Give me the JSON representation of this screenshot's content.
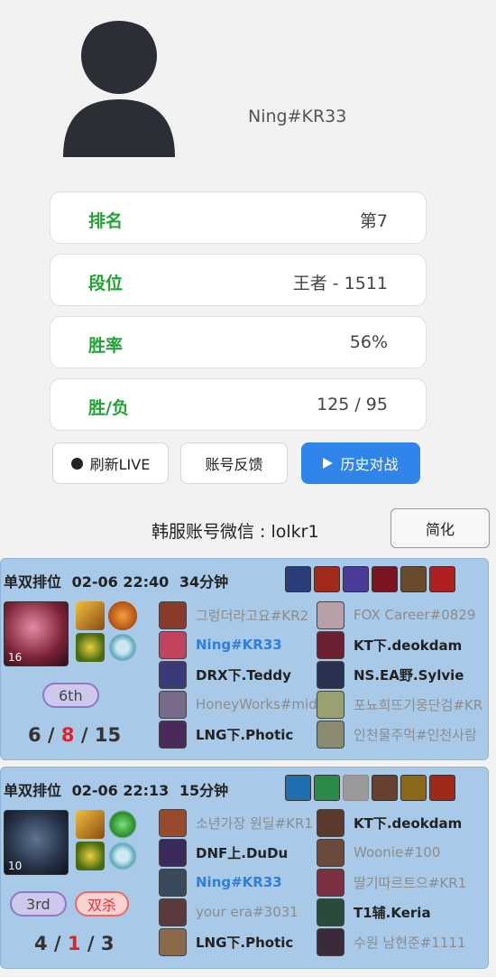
{
  "profile": {
    "name": "Ning#KR33"
  },
  "stats": [
    {
      "label": "排名",
      "value": "第7"
    },
    {
      "label": "段位",
      "value": "王者 - 1511"
    },
    {
      "label": "胜率",
      "value": "56%"
    },
    {
      "label": "胜/负",
      "value": "125 / 95"
    }
  ],
  "actions": {
    "refresh": "刷新LIVE",
    "feedback": "账号反馈",
    "history": "历史对战"
  },
  "wechat": "韩服账号微信 : lolkr1",
  "simplify": "简化",
  "matches": [
    {
      "mode": "单双排位",
      "time": "02-06 22:40",
      "duration": "34分钟",
      "level": "16",
      "rank": "6th",
      "multikill": "",
      "kda": {
        "k": "6",
        "d": "8",
        "a": "15"
      },
      "items": [
        "#2b3d7a",
        "#a22a1a",
        "#4a3a9a",
        "#7a1420",
        "#6a4a2a",
        "#b02020"
      ],
      "team_left": [
        {
          "name": "그렁더라고요#KR2",
          "style": "dim",
          "color": "#8a3a2a"
        },
        {
          "name": "Ning#KR33",
          "style": "me",
          "color": "#c0445e"
        },
        {
          "name": "DRX下.Teddy",
          "style": "bold",
          "color": "#3a3a7a"
        },
        {
          "name": "HoneyWorks#mid",
          "style": "dim",
          "color": "#7a6a8a"
        },
        {
          "name": "LNG下.Photic",
          "style": "bold",
          "color": "#4a2a5a"
        }
      ],
      "team_right": [
        {
          "name": "FOX Career#0829",
          "style": "dim",
          "color": "#b8a0a8"
        },
        {
          "name": "KT下.deokdam",
          "style": "bold",
          "color": "#6a2030"
        },
        {
          "name": "NS.EA野.Sylvie",
          "style": "bold",
          "color": "#2a3050"
        },
        {
          "name": "포뇨희뜨기웅단검#KR",
          "style": "dim",
          "color": "#9aa070"
        },
        {
          "name": "인천물주먹#인천사람",
          "style": "dim",
          "color": "#8a8a70"
        }
      ]
    },
    {
      "mode": "单双排位",
      "time": "02-06 22:13",
      "duration": "15分钟",
      "level": "10",
      "rank": "3rd",
      "multikill": "双杀",
      "kda": {
        "k": "4",
        "d": "1",
        "a": "3"
      },
      "items": [
        "#1f6fb0",
        "#2a8a4a",
        "#9a9a9a",
        "#6a4030",
        "#8a6a1a",
        "#a02a1a"
      ],
      "team_left": [
        {
          "name": "소년가장 원딜#KR1",
          "style": "dim",
          "color": "#9a4a2a"
        },
        {
          "name": "DNF上.DuDu",
          "style": "bold",
          "color": "#3a2a5a"
        },
        {
          "name": "Ning#KR33",
          "style": "me",
          "color": "#3a4a5a"
        },
        {
          "name": "your era#3031",
          "style": "dim",
          "color": "#5a3a3a"
        },
        {
          "name": "LNG下.Photic",
          "style": "bold",
          "color": "#8a6a4a"
        }
      ],
      "team_right": [
        {
          "name": "KT下.deokdam",
          "style": "bold",
          "color": "#5a3a2a"
        },
        {
          "name": "Woonie#100",
          "style": "dim",
          "color": "#6a4a3a"
        },
        {
          "name": "딸기따르트으#KR1",
          "style": "dim",
          "color": "#7a3040"
        },
        {
          "name": "T1辅.Keria",
          "style": "bold",
          "color": "#2a4a3a"
        },
        {
          "name": "수원 남현준#1111",
          "style": "dim",
          "color": "#3a2a3a"
        }
      ]
    }
  ]
}
